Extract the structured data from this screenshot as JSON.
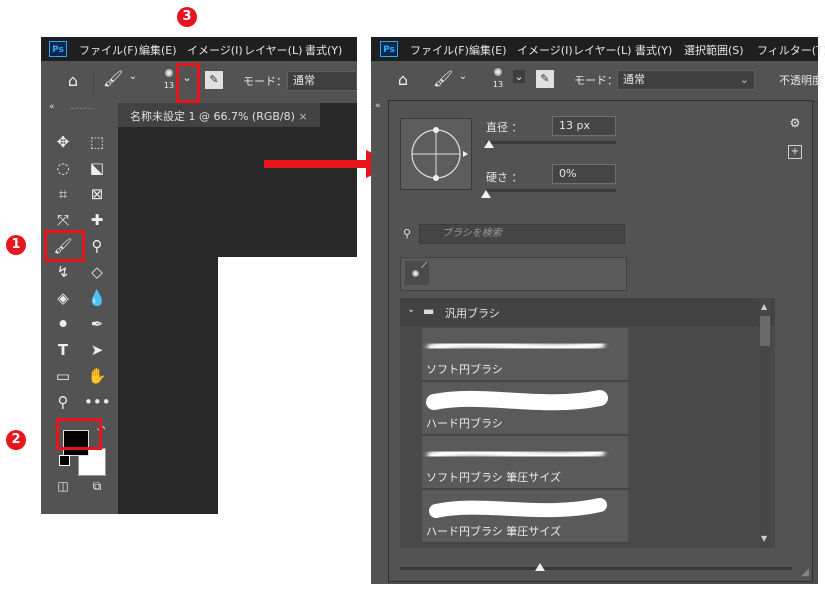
{
  "badges": {
    "b1": "1",
    "b2": "2",
    "b3": "3"
  },
  "menu_left": [
    "ファイル(F)",
    "編集(E)",
    "イメージ(I)",
    "レイヤー(L)",
    "書式(Y)"
  ],
  "menu_right": [
    "ファイル(F)",
    "編集(E)",
    "イメージ(I)",
    "レイヤー(L)",
    "書式(Y)",
    "選択範囲(S)",
    "フィルター(T)"
  ],
  "ps_logo": "Ps",
  "options": {
    "brush_size": "13",
    "mode_label": "モード：",
    "mode_value": "通常",
    "opacity_label": "不透明度"
  },
  "doc_tab": {
    "title": "名称未設定 1 @ 66.7% (RGB/8)",
    "close": "×"
  },
  "brush_popup": {
    "size_label": "直径 ：",
    "size_value": "13 px",
    "hardness_label": "硬さ ：",
    "hardness_value": "0%",
    "size_fraction": 0.02,
    "hardness_fraction": 0.0,
    "search_placeholder": "ブラシを検索",
    "group_name": "汎用ブラシ",
    "brushes": [
      "ソフト円ブラシ",
      "ハード円ブラシ",
      "ソフト円ブラシ 筆圧サイズ",
      "ハード円ブラシ 筆圧サイズ"
    ]
  },
  "colors": {
    "annotation_red": "#e8141b",
    "panel_gray": "#535353",
    "menubar_dark": "#1f1f1f"
  }
}
